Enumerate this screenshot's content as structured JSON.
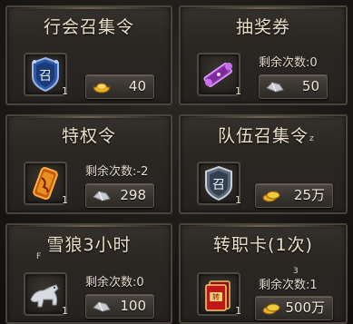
{
  "items": [
    {
      "title": "行会召集令",
      "quantity": "1",
      "price": "40",
      "currency_icon": "gold-ingot-icon",
      "item_icon": "guild-summon-badge-icon"
    },
    {
      "title": "抽奖券",
      "quantity": "1",
      "remaining": "剩余次数:0",
      "price": "50",
      "currency_icon": "silver-ingot-icon",
      "item_icon": "lottery-scroll-icon"
    },
    {
      "title": "特权令",
      "quantity": "1",
      "remaining": "剩余次数:-2",
      "price": "298",
      "currency_icon": "silver-ingot-icon",
      "item_icon": "privilege-token-icon"
    },
    {
      "title": "队伍召集令",
      "title_mark": "z",
      "quantity": "1",
      "price": "25万",
      "currency_icon": "gold-coins-icon",
      "item_icon": "team-summon-badge-icon"
    },
    {
      "title": "雪狼3小时",
      "corner_mark": "F",
      "quantity": "1",
      "remaining": "剩余次数:0",
      "price": "100",
      "currency_icon": "silver-ingot-icon",
      "item_icon": "snow-wolf-icon"
    },
    {
      "title": "转职卡(1次)",
      "remaining_mark": "3",
      "quantity": "1",
      "remaining": "剩余次数:1",
      "price": "500万",
      "currency_icon": "gold-coins-icon",
      "item_icon": "class-change-card-icon"
    }
  ],
  "colors": {
    "panel_border": "#4a443c",
    "title_text": "#e9dfc7",
    "gold": "#e8b028",
    "silver": "#c8ccd0"
  }
}
